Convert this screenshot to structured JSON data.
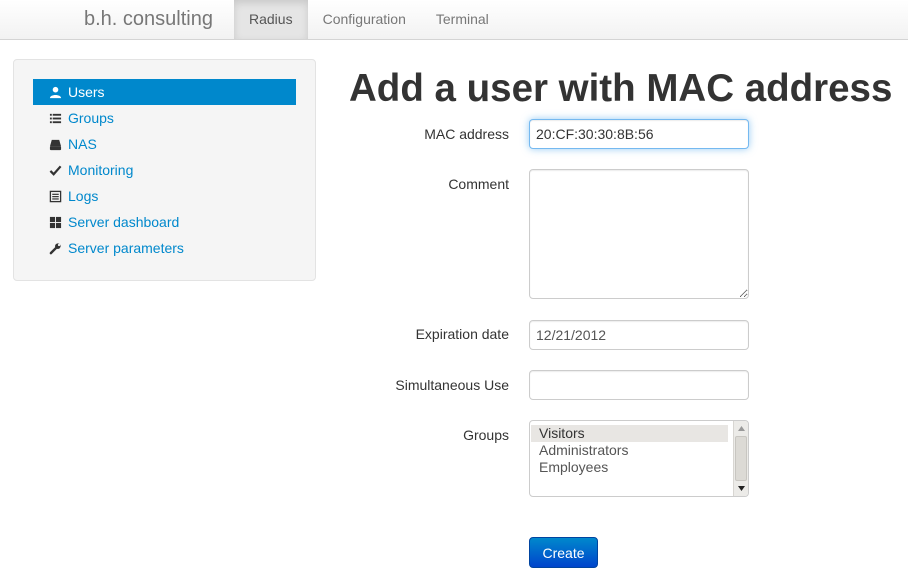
{
  "navbar": {
    "brand": "b.h. consulting",
    "tabs": [
      {
        "label": "Radius",
        "active": true
      },
      {
        "label": "Configuration",
        "active": false
      },
      {
        "label": "Terminal",
        "active": false
      }
    ]
  },
  "sidebar": {
    "items": [
      {
        "label": "Users",
        "icon": "user-icon",
        "active": true
      },
      {
        "label": "Groups",
        "icon": "list-icon",
        "active": false
      },
      {
        "label": "NAS",
        "icon": "hdd-icon",
        "active": false
      },
      {
        "label": "Monitoring",
        "icon": "check-icon",
        "active": false
      },
      {
        "label": "Logs",
        "icon": "list-alt-icon",
        "active": false
      },
      {
        "label": "Server dashboard",
        "icon": "th-large-icon",
        "active": false
      },
      {
        "label": "Server parameters",
        "icon": "wrench-icon",
        "active": false
      }
    ]
  },
  "main": {
    "title": "Add a user with MAC address",
    "mac": {
      "label": "MAC address",
      "value": "20:CF:30:30:8B:56"
    },
    "comment": {
      "label": "Comment",
      "value": ""
    },
    "expiration": {
      "label": "Expiration date",
      "value": "12/21/2012"
    },
    "simultaneous": {
      "label": "Simultaneous Use",
      "value": ""
    },
    "groups": {
      "label": "Groups",
      "options": [
        "Visitors",
        "Administrators",
        "Employees"
      ],
      "selected": "Visitors"
    },
    "create_label": "Create"
  },
  "colors": {
    "accent": "#0088cc",
    "text": "#333333"
  }
}
